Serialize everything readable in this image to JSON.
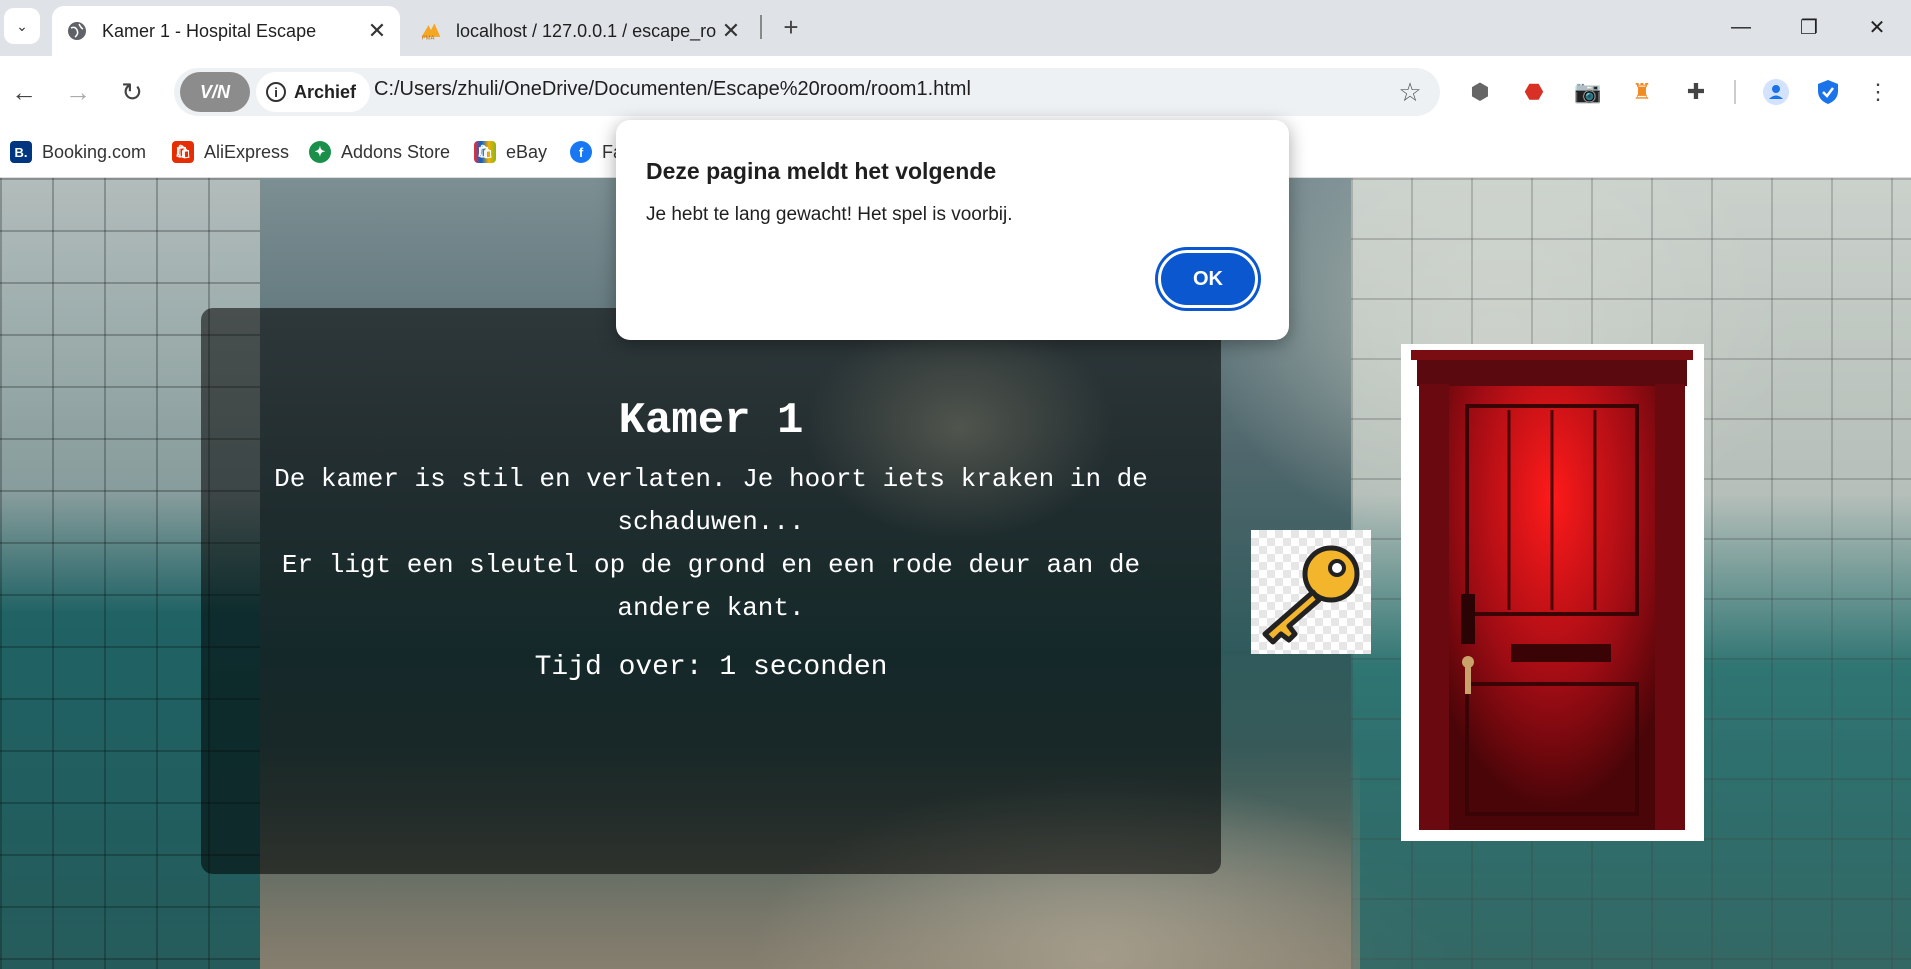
{
  "browser": {
    "tabs": [
      {
        "title": "Kamer 1 - Hospital Escape",
        "active": true
      },
      {
        "title": "localhost / 127.0.0.1 / escape_ro",
        "active": false,
        "favicon_text": "PMA"
      }
    ],
    "new_tab_label": "+",
    "window": {
      "minimize": "—",
      "restore": "❐",
      "close": "✕"
    },
    "toolbar": {
      "vpn_chip": "V/N",
      "info_chip": "Archief",
      "url": "C:/Users/zhuli/OneDrive/Documenten/Escape%20room/room1.html"
    },
    "bookmarks": [
      {
        "label": "Booking.com",
        "icon_text": "B.",
        "color": "#003580"
      },
      {
        "label": "AliExpress",
        "icon_text": "🛍",
        "color": "#e62e04"
      },
      {
        "label": "Addons Store",
        "icon_text": "✦",
        "color": "#1a8f4a"
      },
      {
        "label": "eBay",
        "icon_text": "🛍",
        "color": "#222"
      },
      {
        "label": "Fa",
        "icon_text": "f",
        "color": "#1877f2"
      }
    ]
  },
  "page": {
    "room_title": "Kamer 1",
    "description_line1": "De kamer is stil en verlaten. Je hoort iets kraken in de schaduwen...",
    "description_line2": "Er ligt een sleutel op de grond en een rode deur aan de andere kant.",
    "timer_text": "Tijd over: 1 seconden"
  },
  "dialog": {
    "title": "Deze pagina meldt het volgende",
    "message": "Je hebt te lang gewacht! Het spel is voorbij.",
    "ok_label": "OK"
  },
  "colors": {
    "accent": "#0b57d0",
    "door_red": "#c0101a",
    "key_gold": "#f2b52b"
  }
}
